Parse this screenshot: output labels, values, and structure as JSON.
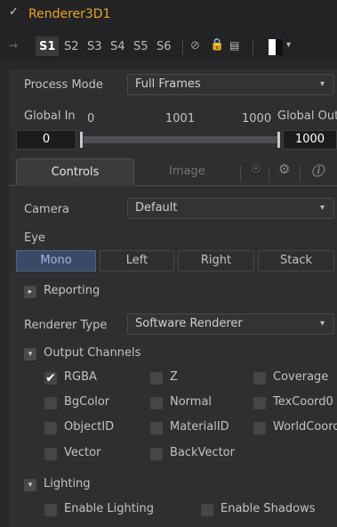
{
  "header": {
    "title": "Renderer3D1",
    "slots": [
      "S1",
      "S2",
      "S3",
      "S4",
      "S5",
      "S6"
    ]
  },
  "process_mode": {
    "label": "Process Mode",
    "value": "Full Frames"
  },
  "range": {
    "global_in_label": "Global In",
    "global_in_value": "0",
    "mid_value": "1001",
    "right_value": "1000",
    "global_out_label": "Global Out",
    "start_field": "0",
    "end_field": "1000"
  },
  "tabs": {
    "controls": "Controls",
    "image": "Image"
  },
  "camera": {
    "label": "Camera",
    "value": "Default"
  },
  "eye": {
    "label": "Eye",
    "options": [
      "Mono",
      "Left",
      "Right",
      "Stack"
    ],
    "selected": "Mono"
  },
  "reporting": {
    "label": "Reporting"
  },
  "renderer_type": {
    "label": "Renderer Type",
    "value": "Software Renderer"
  },
  "output_channels": {
    "label": "Output Channels",
    "items": [
      {
        "label": "RGBA",
        "checked": true
      },
      {
        "label": "Z",
        "checked": false
      },
      {
        "label": "Coverage",
        "checked": false
      },
      {
        "label": "BgColor",
        "checked": false
      },
      {
        "label": "Normal",
        "checked": false
      },
      {
        "label": "TexCoord0",
        "checked": false
      },
      {
        "label": "ObjectID",
        "checked": false
      },
      {
        "label": "MaterialID",
        "checked": false
      },
      {
        "label": "WorldCoord",
        "checked": false
      },
      {
        "label": "Vector",
        "checked": false
      },
      {
        "label": "BackVector",
        "checked": false
      }
    ]
  },
  "lighting": {
    "label": "Lighting",
    "enable_lighting": "Enable Lighting",
    "enable_shadows": "Enable Shadows"
  },
  "colors": {
    "title": "#e8a62a",
    "selected_segment": "#3a4a66"
  }
}
